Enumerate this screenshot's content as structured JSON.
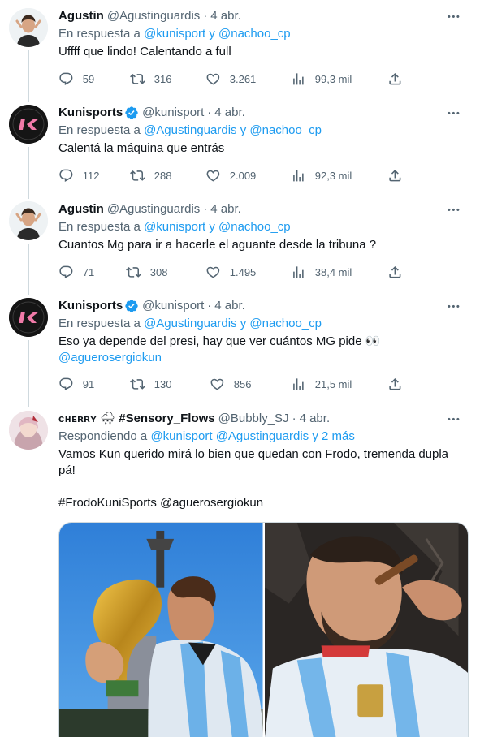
{
  "tweets": [
    {
      "name": "Agustin",
      "handle": "@Agustinguardis",
      "date": "4 abr.",
      "reply_prefix": "En respuesta a",
      "reply_targets": "@kunisport y @nachoo_cp",
      "text": "Uffff que lindo! Calentando a full",
      "replies": "59",
      "retweets": "316",
      "likes": "3.261",
      "views": "99,3 mil",
      "avatar": "person-avatar"
    },
    {
      "name": "Kunisports",
      "verified": true,
      "handle": "@kunisport",
      "date": "4 abr.",
      "reply_prefix": "En respuesta a",
      "reply_targets": "@Agustinguardis y @nachoo_cp",
      "text": "Calentá la máquina que entrás",
      "replies": "112",
      "retweets": "288",
      "likes": "2.009",
      "views": "92,3 mil",
      "avatar": "kunisports-logo"
    },
    {
      "name": "Agustin",
      "handle": "@Agustinguardis",
      "date": "4 abr.",
      "reply_prefix": "En respuesta a",
      "reply_targets": "@kunisport y @nachoo_cp",
      "text": "Cuantos Mg para ir a hacerle el aguante desde la tribuna ?",
      "replies": "71",
      "retweets": "308",
      "likes": "1.495",
      "views": "38,4 mil",
      "avatar": "person-avatar"
    },
    {
      "name": "Kunisports",
      "verified": true,
      "handle": "@kunisport",
      "date": "4 abr.",
      "reply_prefix": "En respuesta a",
      "reply_targets": "@Agustinguardis y @nachoo_cp",
      "text": "Eso ya depende del presi, hay que ver cuántos MG pide 👀",
      "mention": "@aguerosergiokun",
      "replies": "91",
      "retweets": "130",
      "likes": "856",
      "views": "21,5 mil",
      "avatar": "kunisports-logo"
    },
    {
      "name": "ᴄʜᴇʀʀʏ",
      "name_emoji": "🌨",
      "name_suffix": "#Sensory_Flows",
      "handle": "@Bubbly_SJ",
      "date": "4 abr.",
      "reply_prefix": "Respondiendo a",
      "reply_targets": "@kunisport @Agustinguardis y 2 más",
      "text": "Vamos Kun querido mirá lo bien que quedan con Frodo, tremenda dupla pá!",
      "hashtags": "#FrodoKuniSports @aguerosergiokun",
      "avatar": "anime-avatar"
    }
  ],
  "colors": {
    "link": "#1d9bf0",
    "muted": "#536471",
    "text": "#0f1419",
    "thread": "#cfd9de"
  }
}
